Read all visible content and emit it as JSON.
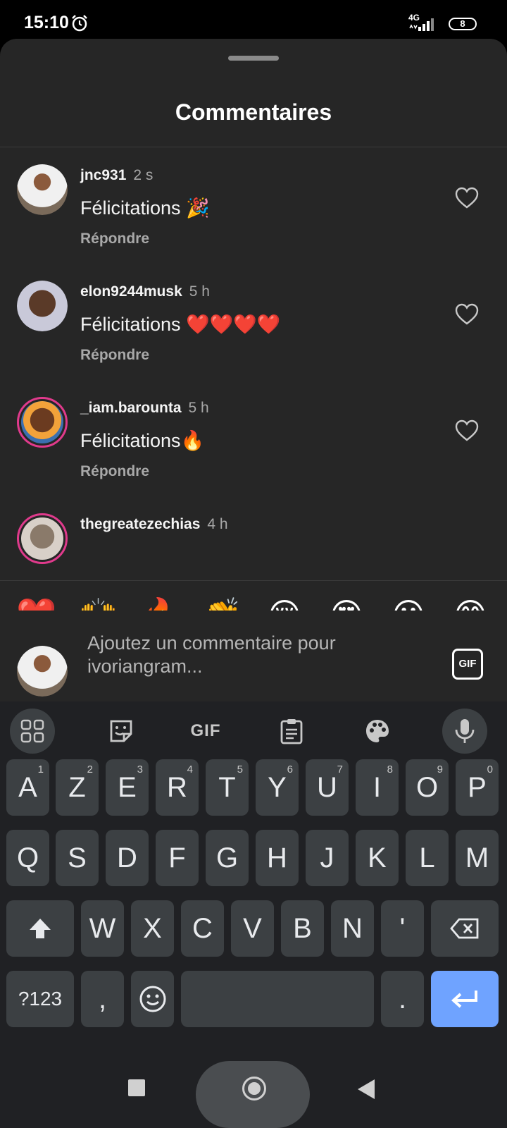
{
  "status": {
    "time": "15:10",
    "network": "4G",
    "battery": "8"
  },
  "sheet": {
    "title": "Commentaires"
  },
  "comments": [
    {
      "user": "jnc931",
      "time": "2 s",
      "text": "Félicitations 🎉",
      "reply": "Répondre"
    },
    {
      "user": "elon9244musk",
      "time": "5 h",
      "text": "Félicitations ❤️❤️❤️❤️",
      "reply": "Répondre"
    },
    {
      "user": "_iam.barounta",
      "time": "5 h",
      "text": "Félicitations🔥",
      "reply": "Répondre"
    },
    {
      "user": "thegreatezechias",
      "time": "4 h",
      "text": "",
      "reply": ""
    }
  ],
  "emojis": [
    "❤️",
    "🙌",
    "🔥",
    "👏",
    "😢",
    "😍",
    "😮",
    "😂"
  ],
  "input": {
    "placeholder": "Ajoutez un commentaire pour ivoriangram...",
    "gif_label": "GIF"
  },
  "keyboard": {
    "toolbar_gif": "GIF",
    "row1": [
      {
        "k": "A",
        "h": "1"
      },
      {
        "k": "Z",
        "h": "2"
      },
      {
        "k": "E",
        "h": "3"
      },
      {
        "k": "R",
        "h": "4"
      },
      {
        "k": "T",
        "h": "5"
      },
      {
        "k": "Y",
        "h": "6"
      },
      {
        "k": "U",
        "h": "7"
      },
      {
        "k": "I",
        "h": "8"
      },
      {
        "k": "O",
        "h": "9"
      },
      {
        "k": "P",
        "h": "0"
      }
    ],
    "row2": [
      "Q",
      "S",
      "D",
      "F",
      "G",
      "H",
      "J",
      "K",
      "L",
      "M"
    ],
    "row3": [
      "W",
      "X",
      "C",
      "V",
      "B",
      "N",
      "'"
    ],
    "symbols_label": "?123",
    "comma": ",",
    "period": "."
  },
  "colors": {
    "sheet": "#262626",
    "keyboard": "#202124",
    "key": "#3c4043",
    "enter": "#6fa3ff",
    "avatar_ring": "#e03a8c"
  }
}
